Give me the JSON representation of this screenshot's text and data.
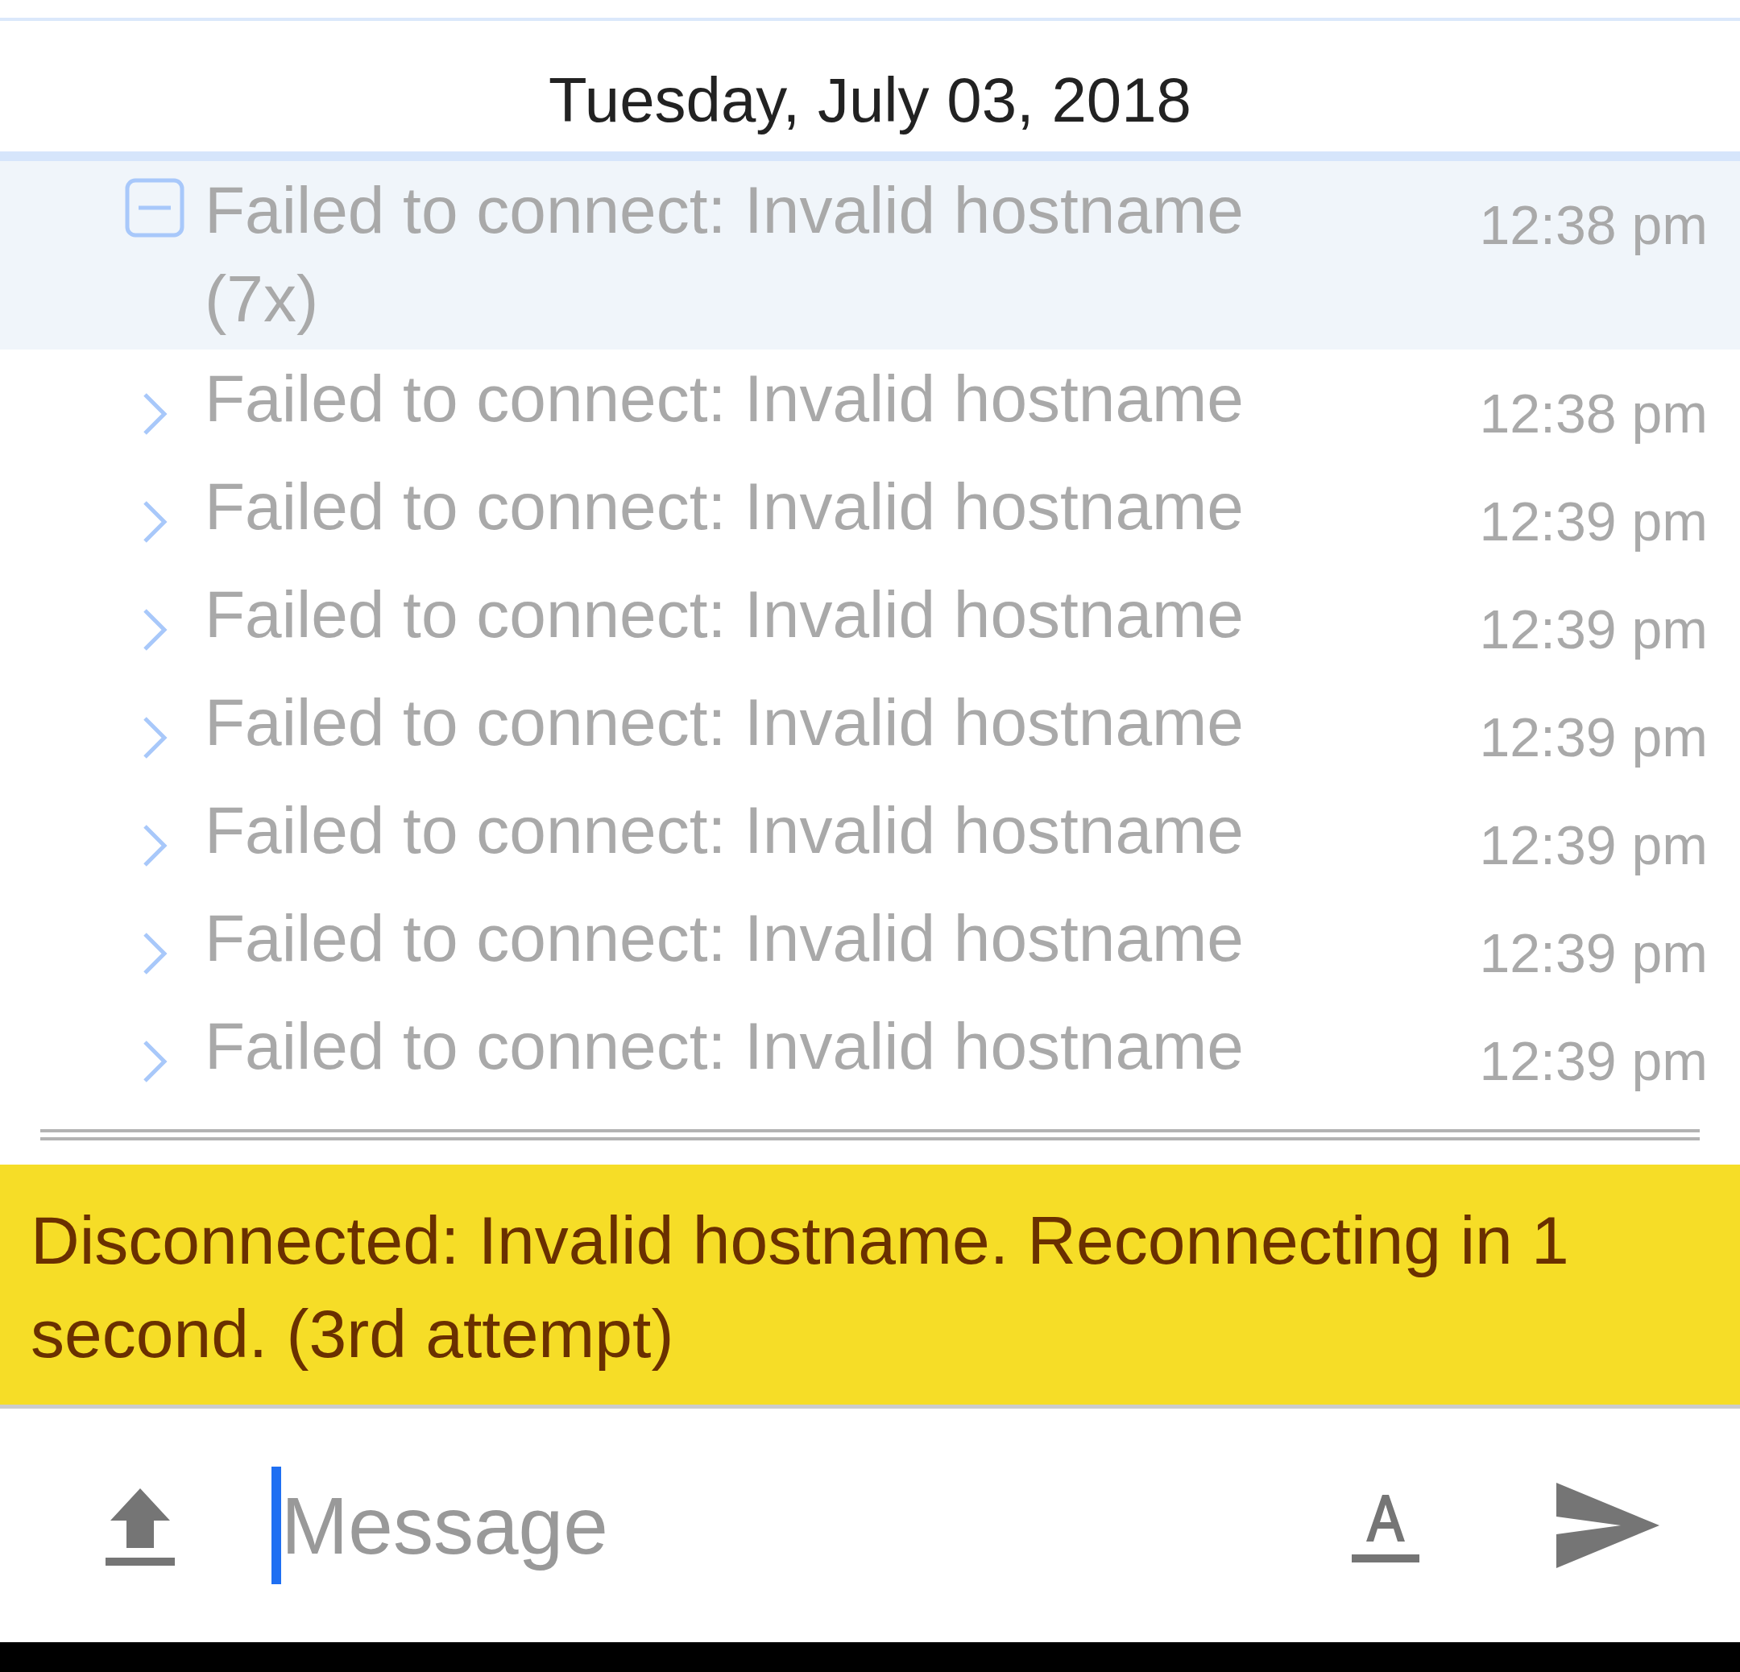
{
  "date_header": "Tuesday, July 03, 2018",
  "messages": [
    {
      "text": "Failed to connect: Invalid hostname (7x)",
      "time": "12:38 pm",
      "expanded": true,
      "children": [
        {
          "text": "Failed to connect: Invalid hostname",
          "time": "12:38 pm",
          "expanded": false
        },
        {
          "text": "Failed to connect: Invalid hostname",
          "time": "12:39 pm",
          "expanded": false
        },
        {
          "text": "Failed to connect: Invalid hostname",
          "time": "12:39 pm",
          "expanded": false
        },
        {
          "text": "Failed to connect: Invalid hostname",
          "time": "12:39 pm",
          "expanded": false
        },
        {
          "text": "Failed to connect: Invalid hostname",
          "time": "12:39 pm",
          "expanded": false
        },
        {
          "text": "Failed to connect: Invalid hostname",
          "time": "12:39 pm",
          "expanded": false
        },
        {
          "text": "Failed to connect: Invalid hostname",
          "time": "12:39 pm",
          "expanded": false
        }
      ]
    }
  ],
  "status_banner": "Disconnected: Invalid hostname. Reconnecting in 1 second. (3rd attempt)",
  "composer": {
    "placeholder": "Message",
    "focused": true
  }
}
